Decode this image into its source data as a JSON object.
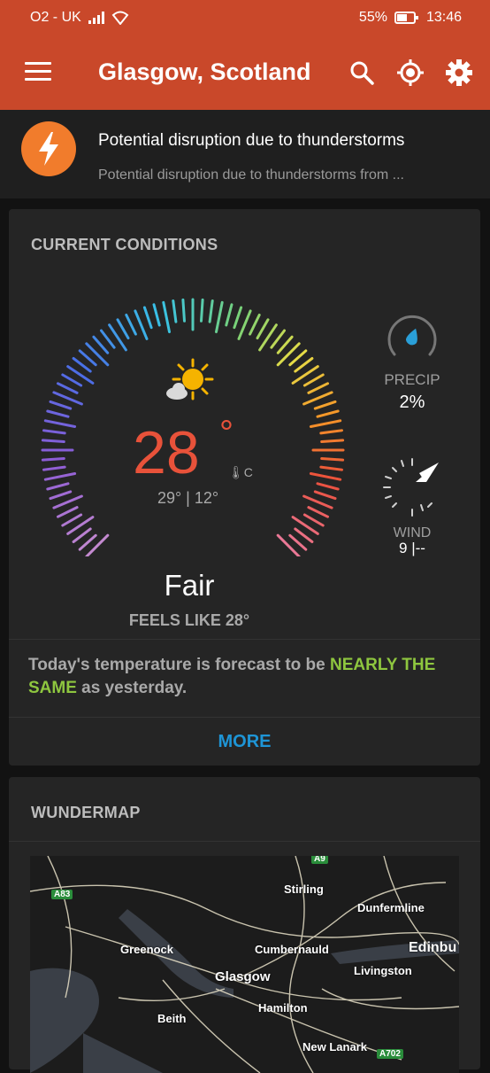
{
  "status": {
    "carrier": "O2 - UK",
    "battery": "55%",
    "time": "13:46"
  },
  "header": {
    "title": "Glasgow, Scotland"
  },
  "alert": {
    "title": "Potential disruption due to thunderstorms",
    "subtitle": "Potential disruption due to thunderstorms from ..."
  },
  "current": {
    "section_title": "CURRENT CONDITIONS",
    "temp": "28",
    "deg": "°",
    "unit": "C",
    "hilo": "29° | 12°",
    "condition": "Fair",
    "feels_like": "FEELS LIKE 28°",
    "precip_label": "PRECIP",
    "precip_value": "2%",
    "wind_label": "WIND",
    "wind_value": "9 |--",
    "forecast_pre": "Today's temperature is forecast to be ",
    "forecast_em": "NEARLY THE SAME",
    "forecast_post": " as yesterday.",
    "more_label": "MORE"
  },
  "map": {
    "section_title": "WUNDERMAP",
    "places": [
      {
        "name": "Stirling"
      },
      {
        "name": "Dunfermline"
      },
      {
        "name": "Greenock"
      },
      {
        "name": "Cumbernauld"
      },
      {
        "name": "Edinbu"
      },
      {
        "name": "Livingston"
      },
      {
        "name": "Glasgow"
      },
      {
        "name": "Hamilton"
      },
      {
        "name": "Beith"
      },
      {
        "name": "New Lanark"
      }
    ],
    "roads": [
      "A83",
      "A9",
      "A702"
    ]
  },
  "colors": {
    "accent": "#c9482a",
    "alert": "#f17c2c",
    "temp": "#e8523a",
    "more": "#1e95d6",
    "highlight": "#8ec63f"
  }
}
